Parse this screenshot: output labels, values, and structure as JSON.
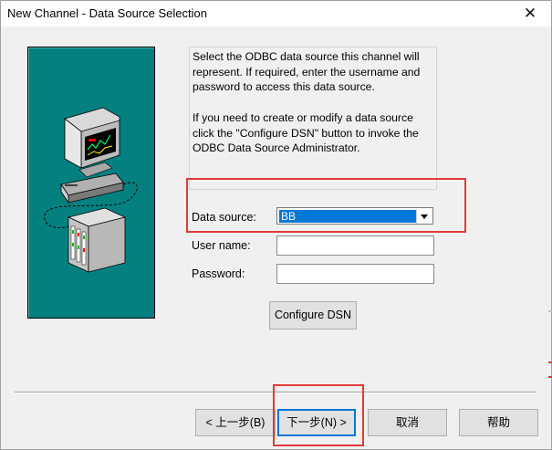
{
  "window": {
    "title": "New Channel - Data Source Selection",
    "close_glyph": "✕"
  },
  "description": {
    "para1": "Select the ODBC data source this channel will represent.  If required, enter the username and password to access this data source.",
    "para2": "If you need to create or modify a data source click the \"Configure DSN\" button to invoke the ODBC Data Source Administrator."
  },
  "form": {
    "data_source_label": "Data source:",
    "data_source_value": "BB",
    "username_label": "User name:",
    "username_value": "",
    "password_label": "Password:",
    "password_value": ""
  },
  "buttons": {
    "configure_dsn": "Configure DSN",
    "back": "< 上一步(B)",
    "next": "下一步(N) >",
    "cancel": "取消",
    "help": "帮助"
  },
  "icons": {
    "computer": "computer-icon",
    "server": "server-icon",
    "dropdown": "chevron-down-icon"
  },
  "colors": {
    "picture_bg": "#048080",
    "selection": "#0078d7",
    "highlight": "#e03a3a"
  }
}
